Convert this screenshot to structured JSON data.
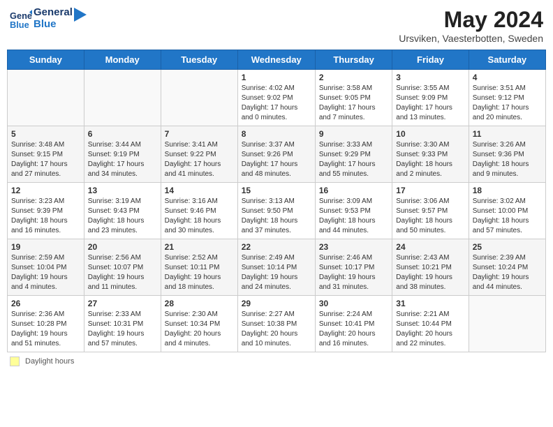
{
  "header": {
    "logo_line1": "General",
    "logo_line2": "Blue",
    "title": "May 2024",
    "subtitle": "Ursviken, Vaesterbotten, Sweden"
  },
  "days_of_week": [
    "Sunday",
    "Monday",
    "Tuesday",
    "Wednesday",
    "Thursday",
    "Friday",
    "Saturday"
  ],
  "weeks": [
    [
      {
        "day": "",
        "info": ""
      },
      {
        "day": "",
        "info": ""
      },
      {
        "day": "",
        "info": ""
      },
      {
        "day": "1",
        "info": "Sunrise: 4:02 AM\nSunset: 9:02 PM\nDaylight: 17 hours\nand 0 minutes."
      },
      {
        "day": "2",
        "info": "Sunrise: 3:58 AM\nSunset: 9:05 PM\nDaylight: 17 hours\nand 7 minutes."
      },
      {
        "day": "3",
        "info": "Sunrise: 3:55 AM\nSunset: 9:09 PM\nDaylight: 17 hours\nand 13 minutes."
      },
      {
        "day": "4",
        "info": "Sunrise: 3:51 AM\nSunset: 9:12 PM\nDaylight: 17 hours\nand 20 minutes."
      }
    ],
    [
      {
        "day": "5",
        "info": "Sunrise: 3:48 AM\nSunset: 9:15 PM\nDaylight: 17 hours\nand 27 minutes."
      },
      {
        "day": "6",
        "info": "Sunrise: 3:44 AM\nSunset: 9:19 PM\nDaylight: 17 hours\nand 34 minutes."
      },
      {
        "day": "7",
        "info": "Sunrise: 3:41 AM\nSunset: 9:22 PM\nDaylight: 17 hours\nand 41 minutes."
      },
      {
        "day": "8",
        "info": "Sunrise: 3:37 AM\nSunset: 9:26 PM\nDaylight: 17 hours\nand 48 minutes."
      },
      {
        "day": "9",
        "info": "Sunrise: 3:33 AM\nSunset: 9:29 PM\nDaylight: 17 hours\nand 55 minutes."
      },
      {
        "day": "10",
        "info": "Sunrise: 3:30 AM\nSunset: 9:33 PM\nDaylight: 18 hours\nand 2 minutes."
      },
      {
        "day": "11",
        "info": "Sunrise: 3:26 AM\nSunset: 9:36 PM\nDaylight: 18 hours\nand 9 minutes."
      }
    ],
    [
      {
        "day": "12",
        "info": "Sunrise: 3:23 AM\nSunset: 9:39 PM\nDaylight: 18 hours\nand 16 minutes."
      },
      {
        "day": "13",
        "info": "Sunrise: 3:19 AM\nSunset: 9:43 PM\nDaylight: 18 hours\nand 23 minutes."
      },
      {
        "day": "14",
        "info": "Sunrise: 3:16 AM\nSunset: 9:46 PM\nDaylight: 18 hours\nand 30 minutes."
      },
      {
        "day": "15",
        "info": "Sunrise: 3:13 AM\nSunset: 9:50 PM\nDaylight: 18 hours\nand 37 minutes."
      },
      {
        "day": "16",
        "info": "Sunrise: 3:09 AM\nSunset: 9:53 PM\nDaylight: 18 hours\nand 44 minutes."
      },
      {
        "day": "17",
        "info": "Sunrise: 3:06 AM\nSunset: 9:57 PM\nDaylight: 18 hours\nand 50 minutes."
      },
      {
        "day": "18",
        "info": "Sunrise: 3:02 AM\nSunset: 10:00 PM\nDaylight: 18 hours\nand 57 minutes."
      }
    ],
    [
      {
        "day": "19",
        "info": "Sunrise: 2:59 AM\nSunset: 10:04 PM\nDaylight: 19 hours\nand 4 minutes."
      },
      {
        "day": "20",
        "info": "Sunrise: 2:56 AM\nSunset: 10:07 PM\nDaylight: 19 hours\nand 11 minutes."
      },
      {
        "day": "21",
        "info": "Sunrise: 2:52 AM\nSunset: 10:11 PM\nDaylight: 19 hours\nand 18 minutes."
      },
      {
        "day": "22",
        "info": "Sunrise: 2:49 AM\nSunset: 10:14 PM\nDaylight: 19 hours\nand 24 minutes."
      },
      {
        "day": "23",
        "info": "Sunrise: 2:46 AM\nSunset: 10:17 PM\nDaylight: 19 hours\nand 31 minutes."
      },
      {
        "day": "24",
        "info": "Sunrise: 2:43 AM\nSunset: 10:21 PM\nDaylight: 19 hours\nand 38 minutes."
      },
      {
        "day": "25",
        "info": "Sunrise: 2:39 AM\nSunset: 10:24 PM\nDaylight: 19 hours\nand 44 minutes."
      }
    ],
    [
      {
        "day": "26",
        "info": "Sunrise: 2:36 AM\nSunset: 10:28 PM\nDaylight: 19 hours\nand 51 minutes."
      },
      {
        "day": "27",
        "info": "Sunrise: 2:33 AM\nSunset: 10:31 PM\nDaylight: 19 hours\nand 57 minutes."
      },
      {
        "day": "28",
        "info": "Sunrise: 2:30 AM\nSunset: 10:34 PM\nDaylight: 20 hours\nand 4 minutes."
      },
      {
        "day": "29",
        "info": "Sunrise: 2:27 AM\nSunset: 10:38 PM\nDaylight: 20 hours\nand 10 minutes."
      },
      {
        "day": "30",
        "info": "Sunrise: 2:24 AM\nSunset: 10:41 PM\nDaylight: 20 hours\nand 16 minutes."
      },
      {
        "day": "31",
        "info": "Sunrise: 2:21 AM\nSunset: 10:44 PM\nDaylight: 20 hours\nand 22 minutes."
      },
      {
        "day": "",
        "info": ""
      }
    ]
  ],
  "footer": {
    "daylight_label": "Daylight hours"
  }
}
